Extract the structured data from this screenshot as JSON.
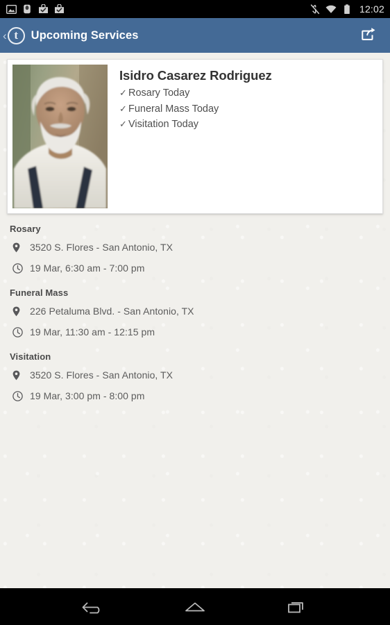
{
  "status_bar": {
    "notification_icons": [
      "image-icon",
      "usb-icon",
      "download-complete-icon",
      "download-complete-icon-2"
    ],
    "system_icons": [
      "mute-icon",
      "wifi-icon",
      "battery-icon"
    ],
    "time": "12:02"
  },
  "app_bar": {
    "back_chevron": "‹",
    "logo_letter": "t",
    "title": "Upcoming Services",
    "share_icon": "share-icon"
  },
  "card": {
    "portrait_alt": "Portrait of deceased",
    "name": "Isidro Casarez Rodriguez",
    "flags": [
      {
        "tick": "✓",
        "label": "Rosary Today"
      },
      {
        "tick": "✓",
        "label": "Funeral Mass Today"
      },
      {
        "tick": "✓",
        "label": "Visitation Today"
      }
    ]
  },
  "sections": [
    {
      "title": "Rosary",
      "location": "3520 S. Flores - San Antonio, TX",
      "time": "19 Mar, 6:30 am - 7:00 pm"
    },
    {
      "title": "Funeral Mass",
      "location": "226 Petaluma Blvd. - San Antonio, TX",
      "time": "19 Mar, 11:30 am - 12:15 pm"
    },
    {
      "title": "Visitation",
      "location": "3520 S. Flores - San Antonio, TX",
      "time": "19 Mar, 3:00 pm - 8:00 pm"
    }
  ],
  "nav_bar": {
    "back": "back-icon",
    "home": "home-icon",
    "recents": "recents-icon"
  },
  "colors": {
    "app_bar": "#446a96",
    "background": "#f1f0ec",
    "card": "#ffffff",
    "status_bar": "#000000",
    "nav_bar": "#000000",
    "title_text": "#ffffff",
    "body_text": "#5c5c5c"
  }
}
